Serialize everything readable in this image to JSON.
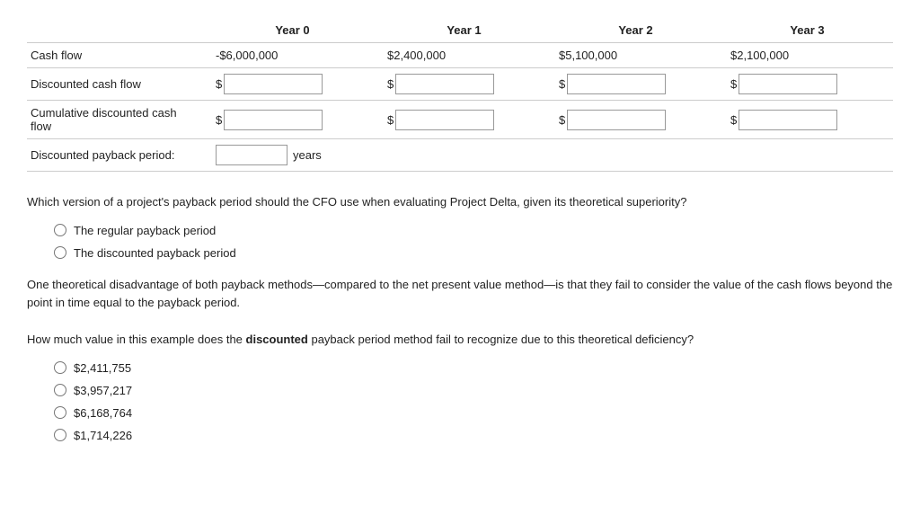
{
  "table": {
    "headers": [
      "",
      "Year 0",
      "Year 1",
      "Year 2",
      "Year 3"
    ],
    "rows": [
      {
        "label": "Cash flow",
        "values": [
          "-$6,000,000",
          "$2,400,000",
          "$5,100,000",
          "$2,100,000"
        ],
        "type": "static"
      },
      {
        "label": "Discounted cash flow",
        "values": [
          "$",
          "$",
          "$",
          "$"
        ],
        "type": "input"
      },
      {
        "label": "Cumulative discounted cash flow",
        "values": [
          "$",
          "$",
          "$",
          "$"
        ],
        "type": "input"
      }
    ],
    "payback_row": {
      "label": "Discounted payback period:",
      "unit": "years"
    }
  },
  "questions": [
    {
      "id": "q1",
      "text": "Which version of a project's payback period should the CFO use when evaluating Project Delta, given its theoretical superiority?",
      "options": [
        {
          "id": "q1a",
          "label": "The regular payback period"
        },
        {
          "id": "q1b",
          "label": "The discounted payback period"
        }
      ]
    }
  ],
  "paragraph": "One theoretical disadvantage of both payback methods—compared to the net present value method—is that they fail to consider the value of the cash flows beyond the point in time equal to the payback period.",
  "question2": {
    "text_before": "How much value in this example does the ",
    "bold_word": "discounted",
    "text_after": " payback period method fail to recognize due to this theoretical deficiency?",
    "options": [
      {
        "id": "q2a",
        "label": "$2,411,755"
      },
      {
        "id": "q2b",
        "label": "$3,957,217"
      },
      {
        "id": "q2c",
        "label": "$6,168,764"
      },
      {
        "id": "q2d",
        "label": "$1,714,226"
      }
    ]
  }
}
